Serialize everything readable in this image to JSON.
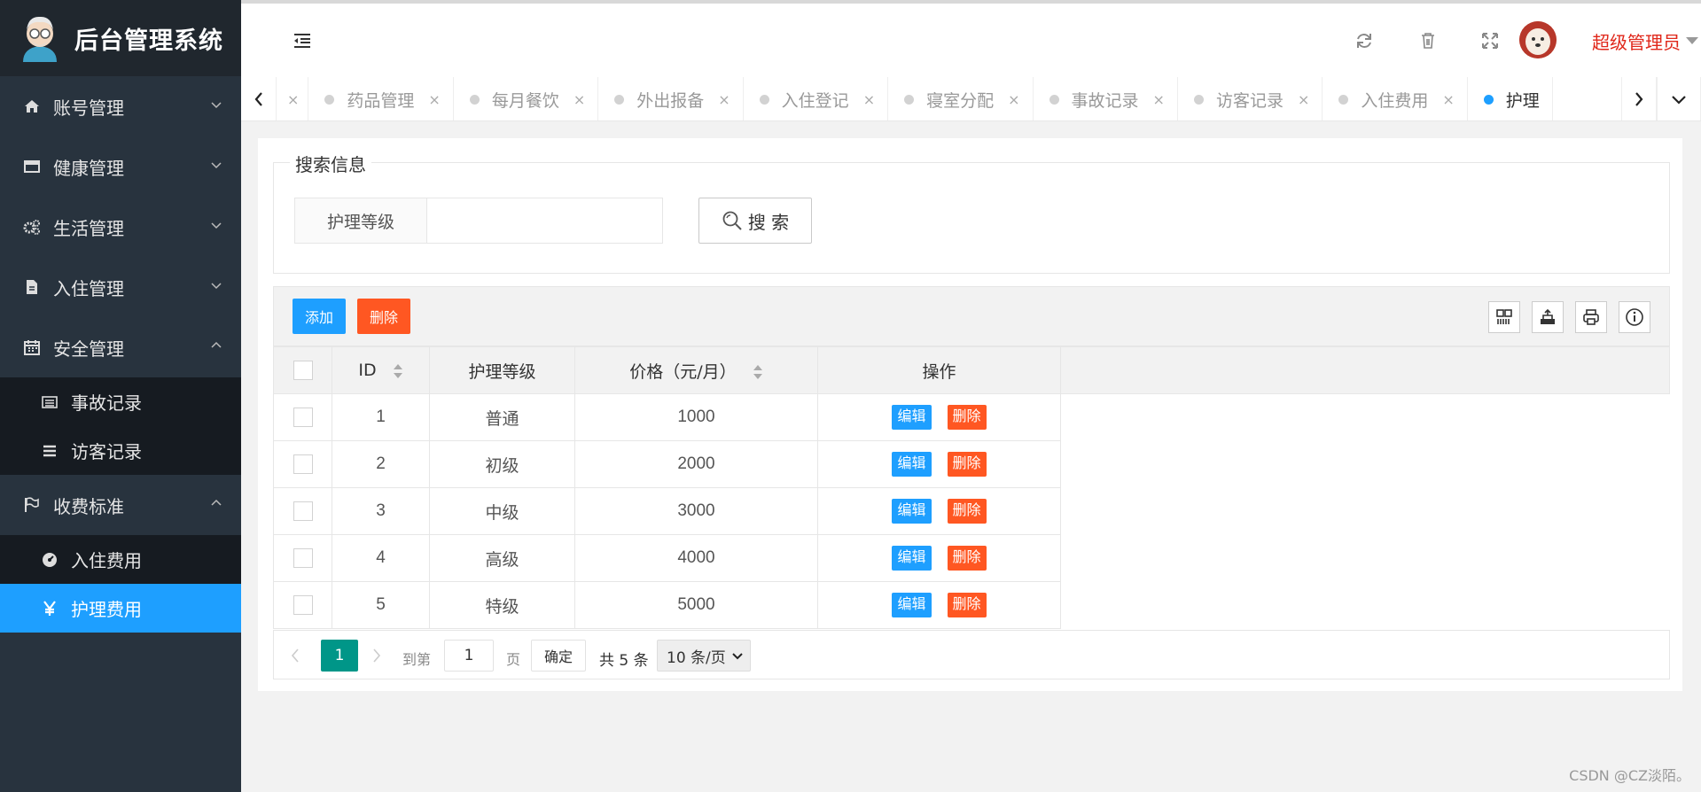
{
  "app": {
    "title": "后台管理系统"
  },
  "sidebar": {
    "items": [
      {
        "label": "账号管理",
        "icon": "home-icon",
        "expanded": false
      },
      {
        "label": "健康管理",
        "icon": "window-icon",
        "expanded": false
      },
      {
        "label": "生活管理",
        "icon": "gears-icon",
        "expanded": false
      },
      {
        "label": "入住管理",
        "icon": "file-icon",
        "expanded": false
      },
      {
        "label": "安全管理",
        "icon": "calendar-icon",
        "expanded": true,
        "children": [
          {
            "label": "事故记录",
            "icon": "list-alt-icon"
          },
          {
            "label": "访客记录",
            "icon": "bars-icon"
          }
        ]
      },
      {
        "label": "收费标准",
        "icon": "flag-icon",
        "expanded": true,
        "children": [
          {
            "label": "入住费用",
            "icon": "tachometer-icon"
          },
          {
            "label": "护理费用",
            "icon": "yen-icon",
            "active": true
          }
        ]
      }
    ]
  },
  "header": {
    "icons": [
      "refresh-icon",
      "trash-icon",
      "fullscreen-icon"
    ],
    "user_name": "超级管理员"
  },
  "tabs": {
    "items": [
      "药品管理",
      "每月餐饮",
      "外出报备",
      "入住登记",
      "寝室分配",
      "事故记录",
      "访客记录",
      "入住费用",
      "护理"
    ],
    "active_index": 8,
    "close_glyph": "×"
  },
  "search": {
    "legend": "搜索信息",
    "field_label": "护理等级",
    "field_value": "",
    "button_label": "搜 索"
  },
  "toolbar": {
    "add_label": "添加",
    "delete_label": "删除",
    "tool_icons": [
      "columns-icon",
      "export-icon",
      "print-icon",
      "info-icon"
    ]
  },
  "table": {
    "headers": [
      "ID",
      "护理等级",
      "价格（元/月）",
      "操作"
    ],
    "rows": [
      {
        "id": "1",
        "level": "普通",
        "price": "1000"
      },
      {
        "id": "2",
        "level": "初级",
        "price": "2000"
      },
      {
        "id": "3",
        "level": "中级",
        "price": "3000"
      },
      {
        "id": "4",
        "level": "高级",
        "price": "4000"
      },
      {
        "id": "5",
        "level": "特级",
        "price": "5000"
      }
    ],
    "edit_label": "编辑",
    "delete_label": "删除"
  },
  "pager": {
    "current_page": "1",
    "goto_prefix": "到第",
    "goto_value": "1",
    "goto_suffix": "页",
    "confirm_label": "确定",
    "total_text": "共 5 条",
    "page_size": "10 条/页"
  },
  "watermark": "CSDN @CZ淡陌。",
  "colors": {
    "primary": "#1e9fff",
    "danger": "#ff5722",
    "page_active": "#009688",
    "sidebar_bg": "#28333e",
    "user_name": "#e0271a"
  }
}
